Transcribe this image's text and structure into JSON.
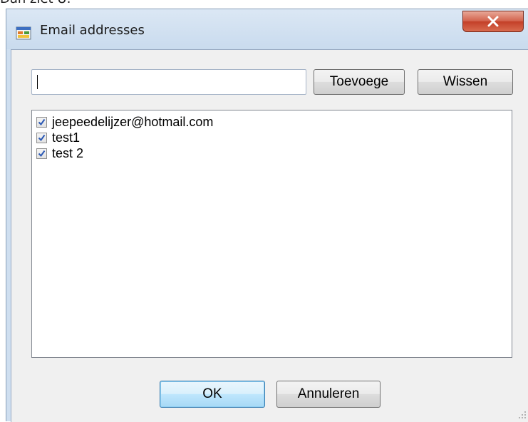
{
  "page_caption": "Dan ziet U:",
  "window": {
    "title": "Email addresses",
    "icon": "form-app-icon",
    "close_icon": "close-x-icon"
  },
  "form": {
    "email_input": {
      "value": "",
      "placeholder": ""
    },
    "add_button_label": "Toevoege",
    "clear_button_label": "Wissen",
    "email_list": [
      {
        "label": "jeepeedelijzer@hotmail.com",
        "checked": true
      },
      {
        "label": "test1",
        "checked": true
      },
      {
        "label": "test 2",
        "checked": true
      }
    ],
    "ok_button_label": "OK",
    "cancel_button_label": "Annuleren"
  },
  "colors": {
    "checkmark": "#2a58b4",
    "close_button": "#c33f28",
    "default_button_border": "#3c7fb1"
  }
}
